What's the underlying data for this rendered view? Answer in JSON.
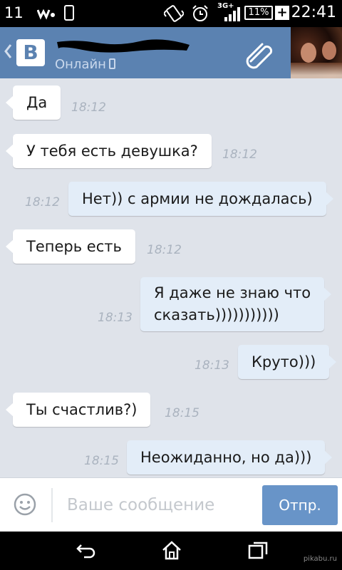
{
  "status_bar": {
    "notification_count": "11",
    "network": "3G+",
    "battery": "11%",
    "time": "22:41",
    "icons": [
      "walkman-icon",
      "phone-icon",
      "vibrate-icon",
      "alarm-icon",
      "signal-icon",
      "battery-icon",
      "charging-icon"
    ]
  },
  "header": {
    "logo": "В",
    "status": "Онлайн"
  },
  "messages": [
    {
      "text": "Да",
      "time": "18:12",
      "dir": "in"
    },
    {
      "text": "У тебя есть девушка?",
      "time": "18:12",
      "dir": "in"
    },
    {
      "text": "Нет)) с армии не дождалась)",
      "time": "18:12",
      "dir": "out"
    },
    {
      "text": "Теперь есть",
      "time": "18:12",
      "dir": "in"
    },
    {
      "lines": [
        "Я даже не знаю что",
        "сказать)))))))))))"
      ],
      "time": "18:13",
      "dir": "out"
    },
    {
      "text": "Круто)))",
      "time": "18:13",
      "dir": "out"
    },
    {
      "text": "Ты счастлив?)",
      "time": "18:15",
      "dir": "in"
    },
    {
      "text": "Неожиданно,  но да)))",
      "time": "18:15",
      "dir": "out"
    }
  ],
  "composer": {
    "placeholder": "Ваше сообщение",
    "value": "",
    "send_label": "Отпр."
  },
  "watermark": "pikabu.ru",
  "colors": {
    "header": "#5b82b1",
    "chat_bg": "#dfe3ea",
    "incoming": "#ffffff",
    "outgoing": "#e3edf8",
    "send_button": "#6894c8"
  }
}
